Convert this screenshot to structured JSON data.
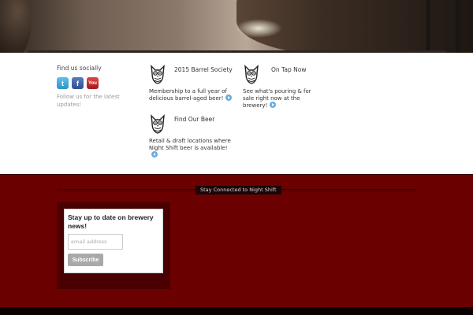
{
  "social": {
    "heading": "Find us socially",
    "icons": [
      {
        "name": "twitter-icon",
        "glyph": "t"
      },
      {
        "name": "facebook-icon",
        "glyph": "f"
      },
      {
        "name": "youtube-icon",
        "glyph": "You"
      }
    ],
    "follow_text": "Follow us for the latest updates!"
  },
  "promos": [
    {
      "title": "2015 Barrel Society",
      "description": "Membership to a full year of delicious barrel-aged beer!"
    },
    {
      "title": "On Tap Now",
      "description": "See what's pouring & for sale right now at the brewery!"
    },
    {
      "title": "Find Our Beer",
      "description": "Retail & draft locations where Night Shift beer is available!"
    }
  ],
  "footer": {
    "connected_label": "Stay Connected to Night Shift",
    "signup": {
      "title": "Stay up to date on brewery news!",
      "email_placeholder": "email address",
      "email_value": "",
      "subscribe_label": "Subscribe"
    }
  },
  "colors": {
    "footer_red": "#6b0000",
    "signup_panel": "#4a0000",
    "link_bullet": "#66aee0"
  }
}
